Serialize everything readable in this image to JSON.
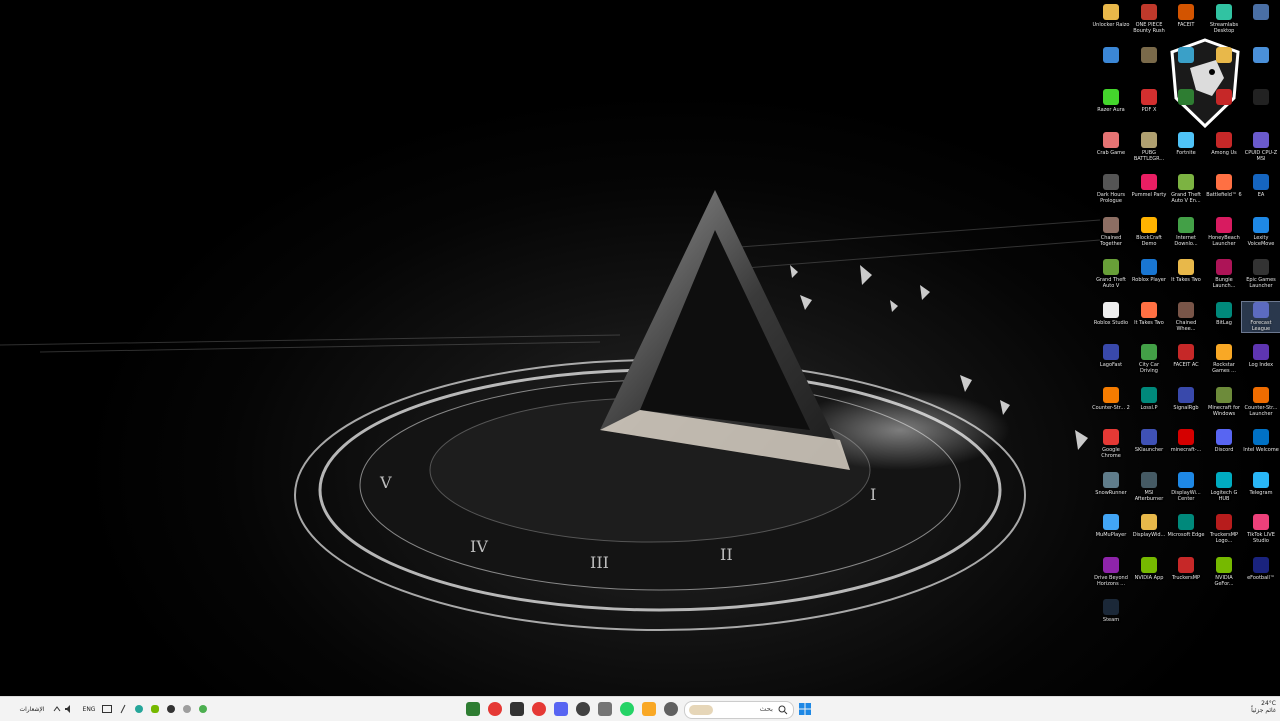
{
  "colors": {
    "taskbar": "#f3f3f3",
    "desktop": "#000000",
    "label": "#e6e6e6",
    "start": "#1e88e5"
  },
  "desktop_icons": [
    {
      "label": "Unlocker Raizo",
      "icon": "folder-icon",
      "color": "#e8b84a"
    },
    {
      "label": "ONE PIECE Bounty Rush",
      "icon": "game-icon",
      "color": "#c0392b"
    },
    {
      "label": "FACEIT",
      "icon": "faceit-icon",
      "color": "#d35400"
    },
    {
      "label": "Streamlabs Desktop",
      "icon": "streamlabs-icon",
      "color": "#31c3a2"
    },
    {
      "label": "",
      "icon": "app-icon",
      "color": "#4a6fa5"
    },
    {
      "label": "",
      "icon": "app-icon",
      "color": "#3b87d6"
    },
    {
      "label": "",
      "icon": "app-icon",
      "color": "#7a6a4a"
    },
    {
      "label": "",
      "icon": "app-icon",
      "color": "#3aa0c8"
    },
    {
      "label": "",
      "icon": "folder-icon",
      "color": "#e8b84a"
    },
    {
      "label": "",
      "icon": "app-icon",
      "color": "#4a90d9"
    },
    {
      "label": "Razer Aura",
      "icon": "razer-icon",
      "color": "#44d62c"
    },
    {
      "label": "PDF X",
      "icon": "pdf-icon",
      "color": "#d32f2f"
    },
    {
      "label": "",
      "icon": "app-icon",
      "color": "#2e7d32"
    },
    {
      "label": "",
      "icon": "app-icon",
      "color": "#c62828"
    },
    {
      "label": "",
      "icon": "app-icon",
      "color": "#222222"
    },
    {
      "label": "Crab Game",
      "icon": "game-icon",
      "color": "#e57373"
    },
    {
      "label": "PUBG BATTLEGR...",
      "icon": "pubg-icon",
      "color": "#b0a070"
    },
    {
      "label": "Fortnite",
      "icon": "fortnite-icon",
      "color": "#4fc3f7"
    },
    {
      "label": "Among Us",
      "icon": "amongus-icon",
      "color": "#c62828"
    },
    {
      "label": "CPUID CPU-Z MSI",
      "icon": "cpuz-icon",
      "color": "#6a5acd"
    },
    {
      "label": "Dark Hours Prologue",
      "icon": "game-icon",
      "color": "#555555"
    },
    {
      "label": "Pummel Party",
      "icon": "game-icon",
      "color": "#e91e63"
    },
    {
      "label": "Grand Theft Auto V En...",
      "icon": "gta-icon",
      "color": "#7cb342"
    },
    {
      "label": "Battlefield™ 6",
      "icon": "battlefield-icon",
      "color": "#ff7043"
    },
    {
      "label": "EA",
      "icon": "ea-icon",
      "color": "#1565c0"
    },
    {
      "label": "Chained Together",
      "icon": "game-icon",
      "color": "#8d6e63"
    },
    {
      "label": "BlockCraft Demo",
      "icon": "game-icon",
      "color": "#ffb300"
    },
    {
      "label": "Internet Downlo...",
      "icon": "idm-icon",
      "color": "#43a047"
    },
    {
      "label": "HoneyBeach Launcher",
      "icon": "game-icon",
      "color": "#d81b60"
    },
    {
      "label": "Lexity VoiceMove",
      "icon": "app-icon",
      "color": "#1e88e5"
    },
    {
      "label": "Grand Theft Auto V",
      "icon": "gta-icon",
      "color": "#689f38"
    },
    {
      "label": "Roblox Player",
      "icon": "roblox-icon",
      "color": "#1976d2"
    },
    {
      "label": "It Takes Two",
      "icon": "folder-icon",
      "color": "#e8b84a"
    },
    {
      "label": "Bungie Launch...",
      "icon": "game-icon",
      "color": "#ad1457"
    },
    {
      "label": "Epic Games Launcher",
      "icon": "epic-icon",
      "color": "#333333"
    },
    {
      "label": "Roblox Studio",
      "icon": "roblox-icon",
      "color": "#eeeeee"
    },
    {
      "label": "It Takes Two",
      "icon": "game-icon",
      "color": "#ff7043"
    },
    {
      "label": "Chained Whee...",
      "icon": "game-icon",
      "color": "#795548"
    },
    {
      "label": "BitLag",
      "icon": "bitlag-icon",
      "color": "#00897b"
    },
    {
      "label": "Forecast League",
      "icon": "app-icon",
      "color": "#5c6bc0",
      "selected": true
    },
    {
      "label": "LagoFast",
      "icon": "lagofast-icon",
      "color": "#3949ab"
    },
    {
      "label": "City Car Driving",
      "icon": "car-icon",
      "color": "#43a047"
    },
    {
      "label": "FACEIT AC",
      "icon": "faceit-icon",
      "color": "#c62828"
    },
    {
      "label": "Rockstar Games ...",
      "icon": "rockstar-icon",
      "color": "#f9a825"
    },
    {
      "label": "Log Index",
      "icon": "app-icon",
      "color": "#5e35b1"
    },
    {
      "label": "Counter-Str... 2",
      "icon": "cs-icon",
      "color": "#f57c00"
    },
    {
      "label": "Lossl.P",
      "icon": "app-icon",
      "color": "#00897b"
    },
    {
      "label": "SignalRgb",
      "icon": "signalrgb-icon",
      "color": "#3949ab"
    },
    {
      "label": "Minecraft for Windows",
      "icon": "minecraft-icon",
      "color": "#6d8b3a"
    },
    {
      "label": "Counter-Str... Launcher",
      "icon": "cs-icon",
      "color": "#ef6c00"
    },
    {
      "label": "Google Chrome",
      "icon": "chrome-icon",
      "color": "#e53935"
    },
    {
      "label": "SKlauncher",
      "icon": "app-icon",
      "color": "#3f51b5"
    },
    {
      "label": "minecraft-...",
      "icon": "opera-icon",
      "color": "#d50000"
    },
    {
      "label": "Discord",
      "icon": "discord-icon",
      "color": "#5865f2"
    },
    {
      "label": "Intel Welcome",
      "icon": "intel-icon",
      "color": "#0071c5"
    },
    {
      "label": "SnowRunner",
      "icon": "game-icon",
      "color": "#607d8b"
    },
    {
      "label": "MSI Afterburner",
      "icon": "afterburner-icon",
      "color": "#455a64"
    },
    {
      "label": "DisplayWi... Center",
      "icon": "app-icon",
      "color": "#1e88e5"
    },
    {
      "label": "Logitech G HUB",
      "icon": "logitech-icon",
      "color": "#00acc1"
    },
    {
      "label": "Telegram",
      "icon": "telegram-icon",
      "color": "#29b6f6"
    },
    {
      "label": "MuMuPlayer",
      "icon": "mumu-icon",
      "color": "#42a5f5"
    },
    {
      "label": "DisplayWid...",
      "icon": "folder-icon",
      "color": "#e8b84a"
    },
    {
      "label": "Microsoft Edge",
      "icon": "edge-icon",
      "color": "#00897b"
    },
    {
      "label": "TruckersMP Logo...",
      "icon": "app-icon",
      "color": "#b71c1c"
    },
    {
      "label": "TikTok LIVE Studio",
      "icon": "tiktok-icon",
      "color": "#ec407a"
    },
    {
      "label": "Drive Beyond Horizons ...",
      "icon": "game-icon",
      "color": "#8e24aa"
    },
    {
      "label": "NVIDIA App",
      "icon": "nvidia-icon",
      "color": "#76b900"
    },
    {
      "label": "TruckersMP",
      "icon": "app-icon",
      "color": "#c62828"
    },
    {
      "label": "NVIDIA GeFor...",
      "icon": "nvidia-icon",
      "color": "#76b900"
    },
    {
      "label": "eFootball™",
      "icon": "efootball-icon",
      "color": "#1a237e"
    },
    {
      "label": "Steam",
      "icon": "steam-icon",
      "color": "#1b2838"
    }
  ],
  "taskbar": {
    "tray": {
      "lang": "ENG",
      "notification_text": "الإشعارات"
    },
    "pinned": [
      {
        "name": "files-app",
        "color": "#2e7d32"
      },
      {
        "name": "chrome",
        "color": "#e53935"
      },
      {
        "name": "obs",
        "color": "#333333"
      },
      {
        "name": "chrome-2",
        "color": "#e53935"
      },
      {
        "name": "discord",
        "color": "#5865f2"
      },
      {
        "name": "app",
        "color": "#424242"
      },
      {
        "name": "settings",
        "color": "#757575"
      },
      {
        "name": "whatsapp",
        "color": "#25d366"
      },
      {
        "name": "file-explorer",
        "color": "#f9a825"
      },
      {
        "name": "task-view",
        "color": "#616161"
      }
    ],
    "search": {
      "placeholder": "بحث"
    },
    "clock": {
      "temp": "24°C",
      "status": "غائم جزئياً"
    }
  }
}
